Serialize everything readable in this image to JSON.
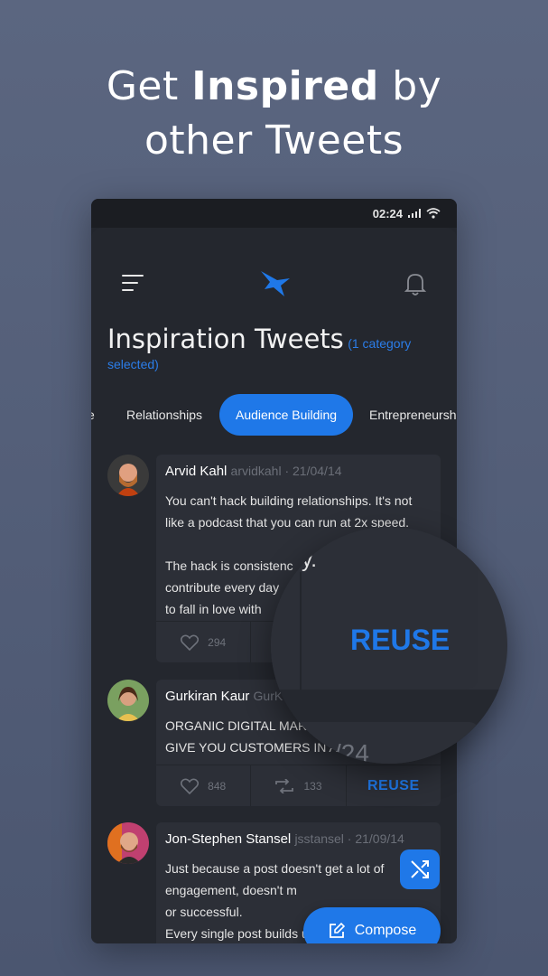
{
  "headline": {
    "line1_pre": "Get ",
    "line1_bold": "Inspired",
    "line1_post": " by",
    "line2": "other Tweets"
  },
  "status_bar": {
    "time": "02:24"
  },
  "page": {
    "title": "Inspiration Tweets",
    "subtitle": "(1 category selected)"
  },
  "tabs": [
    {
      "label": "e"
    },
    {
      "label": "Relationships"
    },
    {
      "label": "Audience Building",
      "active": true
    },
    {
      "label": "Entrepreneurship"
    }
  ],
  "tweets": [
    {
      "name": "Arvid Kahl",
      "handle": "arvidkahl · 21/04/14",
      "lines": [
        "You can't hack building relationships. It's not",
        "like a podcast that you can run at 2x speed.",
        "",
        "The hack is consistenc",
        "contribute every day",
        "to fall in love with"
      ],
      "likes": "294"
    },
    {
      "name": "Gurkiran Kaur",
      "handle": "GurK",
      "lines": [
        "ORGANIC DIGITAL MARI",
        "GIVE YOU CUSTOMERS IN A"
      ],
      "likes": "848",
      "retweets": "133",
      "reuse": "REUSE"
    },
    {
      "name": "Jon-Stephen Stansel",
      "handle": "jsstansel · 21/09/14",
      "lines": [
        "Just because a post doesn't get a lot of",
        "engagement, doesn't m",
        "or successful.",
        "Every single post builds up to that one that"
      ]
    }
  ],
  "magnifier": {
    "text_fragment": "y.",
    "reuse": "REUSE",
    "bottom_fragment": "/24"
  },
  "buttons": {
    "compose": "Compose"
  },
  "colors": {
    "accent": "#1f78e8",
    "background": "#24272e",
    "card": "#2c2f37"
  }
}
